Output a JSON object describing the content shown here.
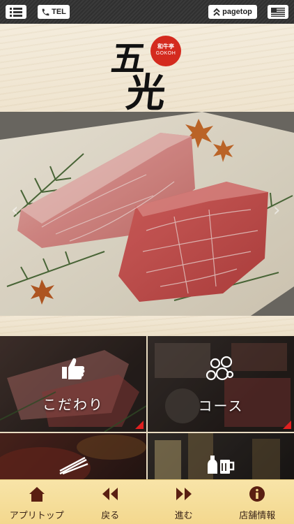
{
  "topbar": {
    "menu_icon": "list-icon",
    "tel_label": "TEL",
    "tel_icon": "phone-icon",
    "pagetop_label": "pagetop",
    "pagetop_icon": "double-chevron-up-icon",
    "flag_icon": "flag-icon"
  },
  "logo": {
    "kanji_1": "五",
    "kanji_2": "光",
    "circle_sub": "和牛亭",
    "circle_en": "GOKOH",
    "circle_color": "#d42a1e"
  },
  "hero": {
    "prev_glyph": "‹",
    "next_glyph": "›"
  },
  "tiles": [
    {
      "label": "こだわり",
      "icon": "thumbs-up-icon"
    },
    {
      "label": "コース",
      "icon": "bubbles-icon"
    },
    {
      "label": "",
      "icon": "chopsticks-icon"
    },
    {
      "label": "",
      "icon": "drinks-icon"
    }
  ],
  "bottom_nav": [
    {
      "label": "アプリトップ",
      "icon": "home-icon"
    },
    {
      "label": "戻る",
      "icon": "back-icon"
    },
    {
      "label": "進む",
      "icon": "forward-icon"
    },
    {
      "label": "店舗情報",
      "icon": "info-icon"
    }
  ],
  "colors": {
    "nav_bg": "#f3d88e",
    "nav_icon": "#5a1f12",
    "accent_red": "#e02020"
  }
}
